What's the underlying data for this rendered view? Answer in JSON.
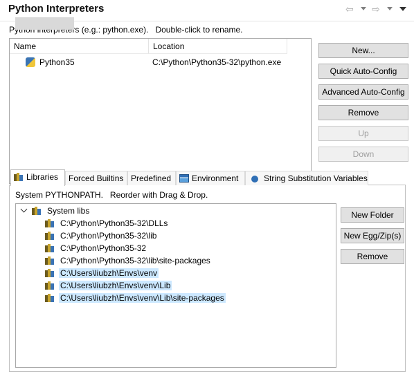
{
  "header": {
    "title": "Python Interpreters",
    "nav_icons": [
      "back-arrow-icon",
      "forward-arrow-icon",
      "view-menu-icon"
    ]
  },
  "interpreters": {
    "description": "Python interpreters (e.g.: python.exe).   Double-click to rename.",
    "columns": [
      "Name",
      "Location"
    ],
    "rows": [
      {
        "name": "Python35",
        "location": "C:\\Python\\Python35-32\\python.exe"
      }
    ]
  },
  "interpreter_buttons": {
    "new": "New...",
    "quick_auto_config": "Quick Auto-Config",
    "advanced_auto_config": "Advanced Auto-Config",
    "remove": "Remove",
    "up": "Up",
    "down": "Down"
  },
  "tabs": [
    {
      "label": "Libraries",
      "icon": "libraries-icon",
      "active": true
    },
    {
      "label": "Forced Builtins",
      "active": false
    },
    {
      "label": "Predefined",
      "active": false
    },
    {
      "label": "Environment",
      "icon": "environment-icon",
      "active": false
    },
    {
      "label": "String Substitution Variables",
      "icon": "variables-icon",
      "active": false
    }
  ],
  "libraries": {
    "description": "System PYTHONPATH.   Reorder with Drag & Drop.",
    "root_label": "System libs",
    "paths": [
      {
        "path": "C:\\Python\\Python35-32\\DLLs",
        "selected": false
      },
      {
        "path": "C:\\Python\\Python35-32\\lib",
        "selected": false
      },
      {
        "path": "C:\\Python\\Python35-32",
        "selected": false
      },
      {
        "path": "C:\\Python\\Python35-32\\lib\\site-packages",
        "selected": false
      },
      {
        "path": "C:\\Users\\liubzh\\Envs\\venv",
        "selected": true
      },
      {
        "path": "C:\\Users\\liubzh\\Envs\\venv\\Lib",
        "selected": true
      },
      {
        "path": "C:\\Users\\liubzh\\Envs\\venv\\Lib\\site-packages",
        "selected": true
      }
    ]
  },
  "library_buttons": {
    "new_folder": "New Folder",
    "new_egg_zip": "New Egg/Zip(s)",
    "remove": "Remove"
  },
  "colors": {
    "selection": "#cce8ff",
    "interpreter_selection": "#d9d9d9",
    "button_face": "#e1e1e1"
  }
}
